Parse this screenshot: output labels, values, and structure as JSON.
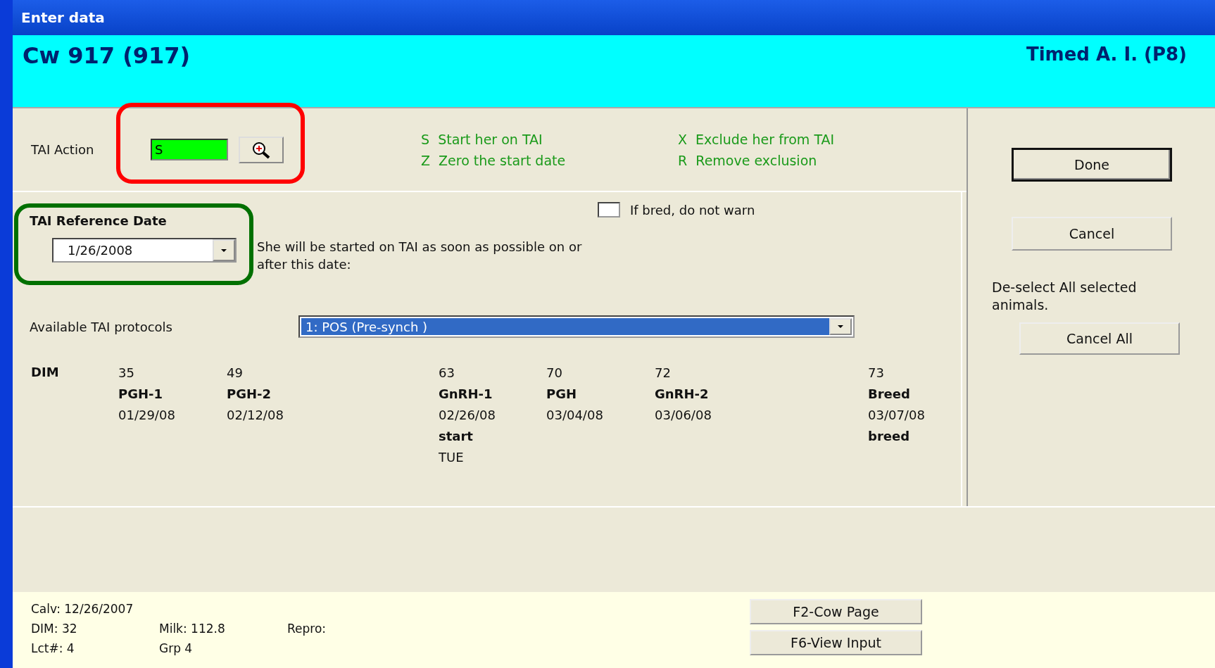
{
  "window": {
    "title": "Enter data"
  },
  "header": {
    "animal": "Cw 917 (917)",
    "event": "Timed A. I. (P8)"
  },
  "tai_action": {
    "label": "TAI Action",
    "value": "S",
    "highlight": {
      "color": "#ff0000"
    }
  },
  "action_legend": [
    {
      "code": "S",
      "text": "Start her on TAI"
    },
    {
      "code": "X",
      "text": "Exclude her from TAI"
    },
    {
      "code": "Z",
      "text": "Zero the start date"
    },
    {
      "code": "R",
      "text": "Remove exclusion"
    }
  ],
  "if_bred_checkbox": {
    "label": "If bred, do not warn",
    "checked": false
  },
  "reference_date": {
    "label": "TAI Reference Date",
    "value": "1/26/2008",
    "highlight": {
      "color": "#007000"
    }
  },
  "reference_note": "She will be started on TAI as soon as possible on or after this date:",
  "protocols": {
    "label": "Available TAI protocols",
    "value": "1: POS  (Pre-synch  )"
  },
  "schedule": {
    "label": "DIM",
    "columns": [
      {
        "dim": "35",
        "event": "PGH-1",
        "date": "01/29/08"
      },
      {
        "dim": "49",
        "event": "PGH-2",
        "date": "02/12/08"
      },
      {
        "dim": "63",
        "event": "GnRH-1",
        "date": "02/26/08",
        "note": "start",
        "day": "TUE"
      },
      {
        "dim": "70",
        "event": "PGH",
        "date": "03/04/08"
      },
      {
        "dim": "72",
        "event": "GnRH-2",
        "date": "03/06/08"
      },
      {
        "dim": "73",
        "event": "Breed",
        "date": "03/07/08",
        "note": "breed"
      }
    ]
  },
  "side_buttons": [
    {
      "label": "Done",
      "default": true
    },
    {
      "label": "Cancel",
      "default": false
    }
  ],
  "deselect_note": "De-select All selected animals.",
  "cancel_all_button": "Cancel All",
  "info": [
    [
      "Calv: 12/26/2007"
    ],
    [
      "DIM: 32",
      "Milk: 112.8",
      "Repro:"
    ],
    [
      "Lct#: 4",
      "Grp  4"
    ]
  ],
  "footer_buttons": [
    "F2-Cow Page",
    "F6-View Input"
  ]
}
